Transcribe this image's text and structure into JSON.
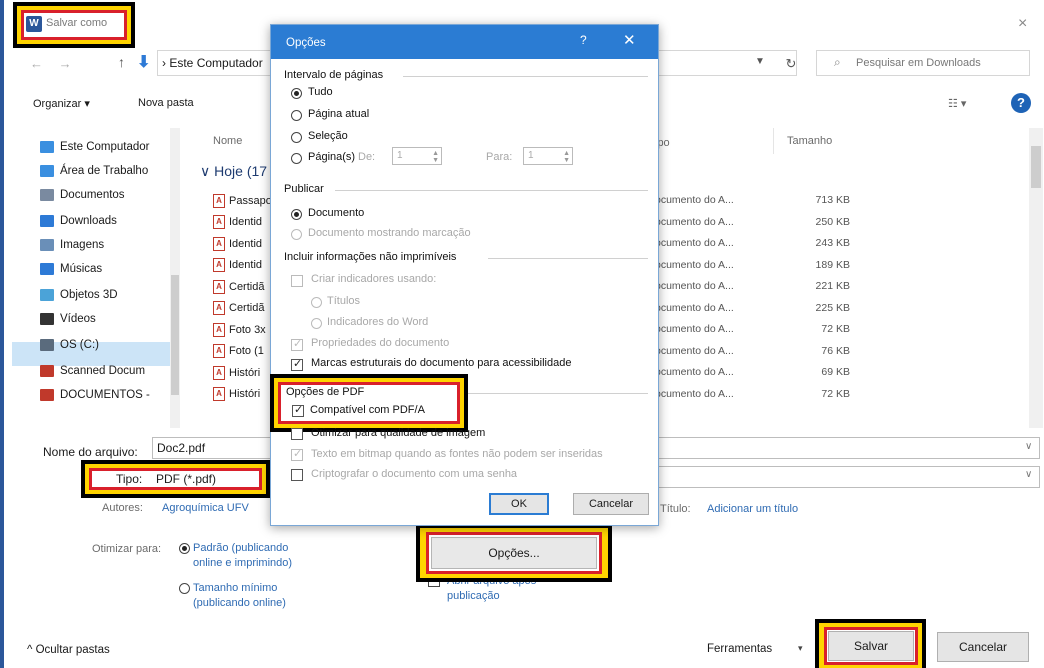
{
  "window": {
    "title": "Salvar como",
    "close": "×"
  },
  "address": {
    "path": "Este Computador",
    "path_sep": "›",
    "search_placeholder": "Pesquisar em Downloads"
  },
  "toolbar": {
    "organize": "Organizar ▾",
    "new_folder": "Nova pasta",
    "view": "☷ ▾",
    "help": "?"
  },
  "sidebar": {
    "items": [
      {
        "label": "Este Computador",
        "color": "#3a8fe0"
      },
      {
        "label": "Área de Trabalho",
        "color": "#3a8fe0"
      },
      {
        "label": "Documentos",
        "color": "#7a8aa0"
      },
      {
        "label": "Downloads",
        "color": "#2d7ad6"
      },
      {
        "label": "Imagens",
        "color": "#6a8fb8"
      },
      {
        "label": "Músicas",
        "color": "#2d7ad6"
      },
      {
        "label": "Objetos 3D",
        "color": "#4ba3d8"
      },
      {
        "label": "Vídeos",
        "color": "#333333"
      },
      {
        "label": "OS (C:)",
        "color": "#5a6b7d"
      },
      {
        "label": "Scanned Docum",
        "color": "#c0392b"
      },
      {
        "label": "DOCUMENTOS -",
        "color": "#c0392b"
      }
    ]
  },
  "files": {
    "col_name": "Nome",
    "col_type": "ipo",
    "col_size": "Tamanho",
    "group": "Hoje (17",
    "rows": [
      {
        "name": "Passapo",
        "type": "ocumento do A...",
        "size": "713 KB"
      },
      {
        "name": "Identid",
        "type": "ocumento do A...",
        "size": "250 KB"
      },
      {
        "name": "Identid",
        "type": "ocumento do A...",
        "size": "243 KB"
      },
      {
        "name": "Identid",
        "type": "ocumento do A...",
        "size": "189 KB"
      },
      {
        "name": "Certidã",
        "type": "ocumento do A...",
        "size": "221 KB"
      },
      {
        "name": "Certidã",
        "type": "ocumento do A...",
        "size": "225 KB"
      },
      {
        "name": "Foto 3x",
        "type": "ocumento do A...",
        "size": "72 KB"
      },
      {
        "name": "Foto (1",
        "type": "ocumento do A...",
        "size": "76 KB"
      },
      {
        "name": "Históri",
        "type": "ocumento do A...",
        "size": "69 KB"
      },
      {
        "name": "Históri",
        "type": "ocumento do A...",
        "size": "72 KB"
      }
    ]
  },
  "form": {
    "filename_label": "Nome do arquivo:",
    "filename_value": "Doc2.pdf",
    "type_label": "Tipo:",
    "type_value": "PDF (*.pdf)",
    "authors_label": "Autores:",
    "authors_value": "Agroquímica UFV",
    "title_label": "Título:",
    "title_value": "Adicionar um título",
    "optimize_label": "Otimizar para:",
    "optimize_opt1_l1": "Padrão (publicando",
    "optimize_opt1_l2": "online e imprimindo)",
    "optimize_opt2_l1": "Tamanho mínimo",
    "optimize_opt2_l2": "(publicando online)",
    "publish_l1": "Abrir arquivo após",
    "publish_l2": "publicação",
    "options_button": "Opções...",
    "hide_folders": "^  Ocultar pastas",
    "tools": "Ferramentas",
    "tools_caret": "▾",
    "save": "Salvar",
    "cancel": "Cancelar"
  },
  "dialog": {
    "title": "Opções",
    "help": "?",
    "close": "✕",
    "page_range": {
      "heading": "Intervalo de páginas",
      "all": "Tudo",
      "current": "Página atual",
      "selection": "Seleção",
      "pages": "Página(s)",
      "from_label": "De:",
      "from_value": "1",
      "to_label": "Para:",
      "to_value": "1"
    },
    "publish": {
      "heading": "Publicar",
      "document": "Documento",
      "document_markup": "Documento mostrando marcação"
    },
    "nonprint": {
      "heading": "Incluir informações não imprimíveis",
      "create_bookmarks": "Criar indicadores usando:",
      "headings": "Títulos",
      "word_bookmarks": "Indicadores do Word",
      "doc_props": "Propriedades do documento",
      "struct_tags": "Marcas estruturais do documento para acessibilidade"
    },
    "pdf": {
      "heading": "Opções de PDF",
      "pdfa": "Compatível com PDF/A",
      "optimize_image": "Otimizar para qualidade de imagem",
      "bitmap_text": "Texto em bitmap quando as fontes não podem ser inseridas",
      "encrypt": "Criptografar o documento com uma senha"
    },
    "ok": "OK",
    "cancel": "Cancelar"
  }
}
